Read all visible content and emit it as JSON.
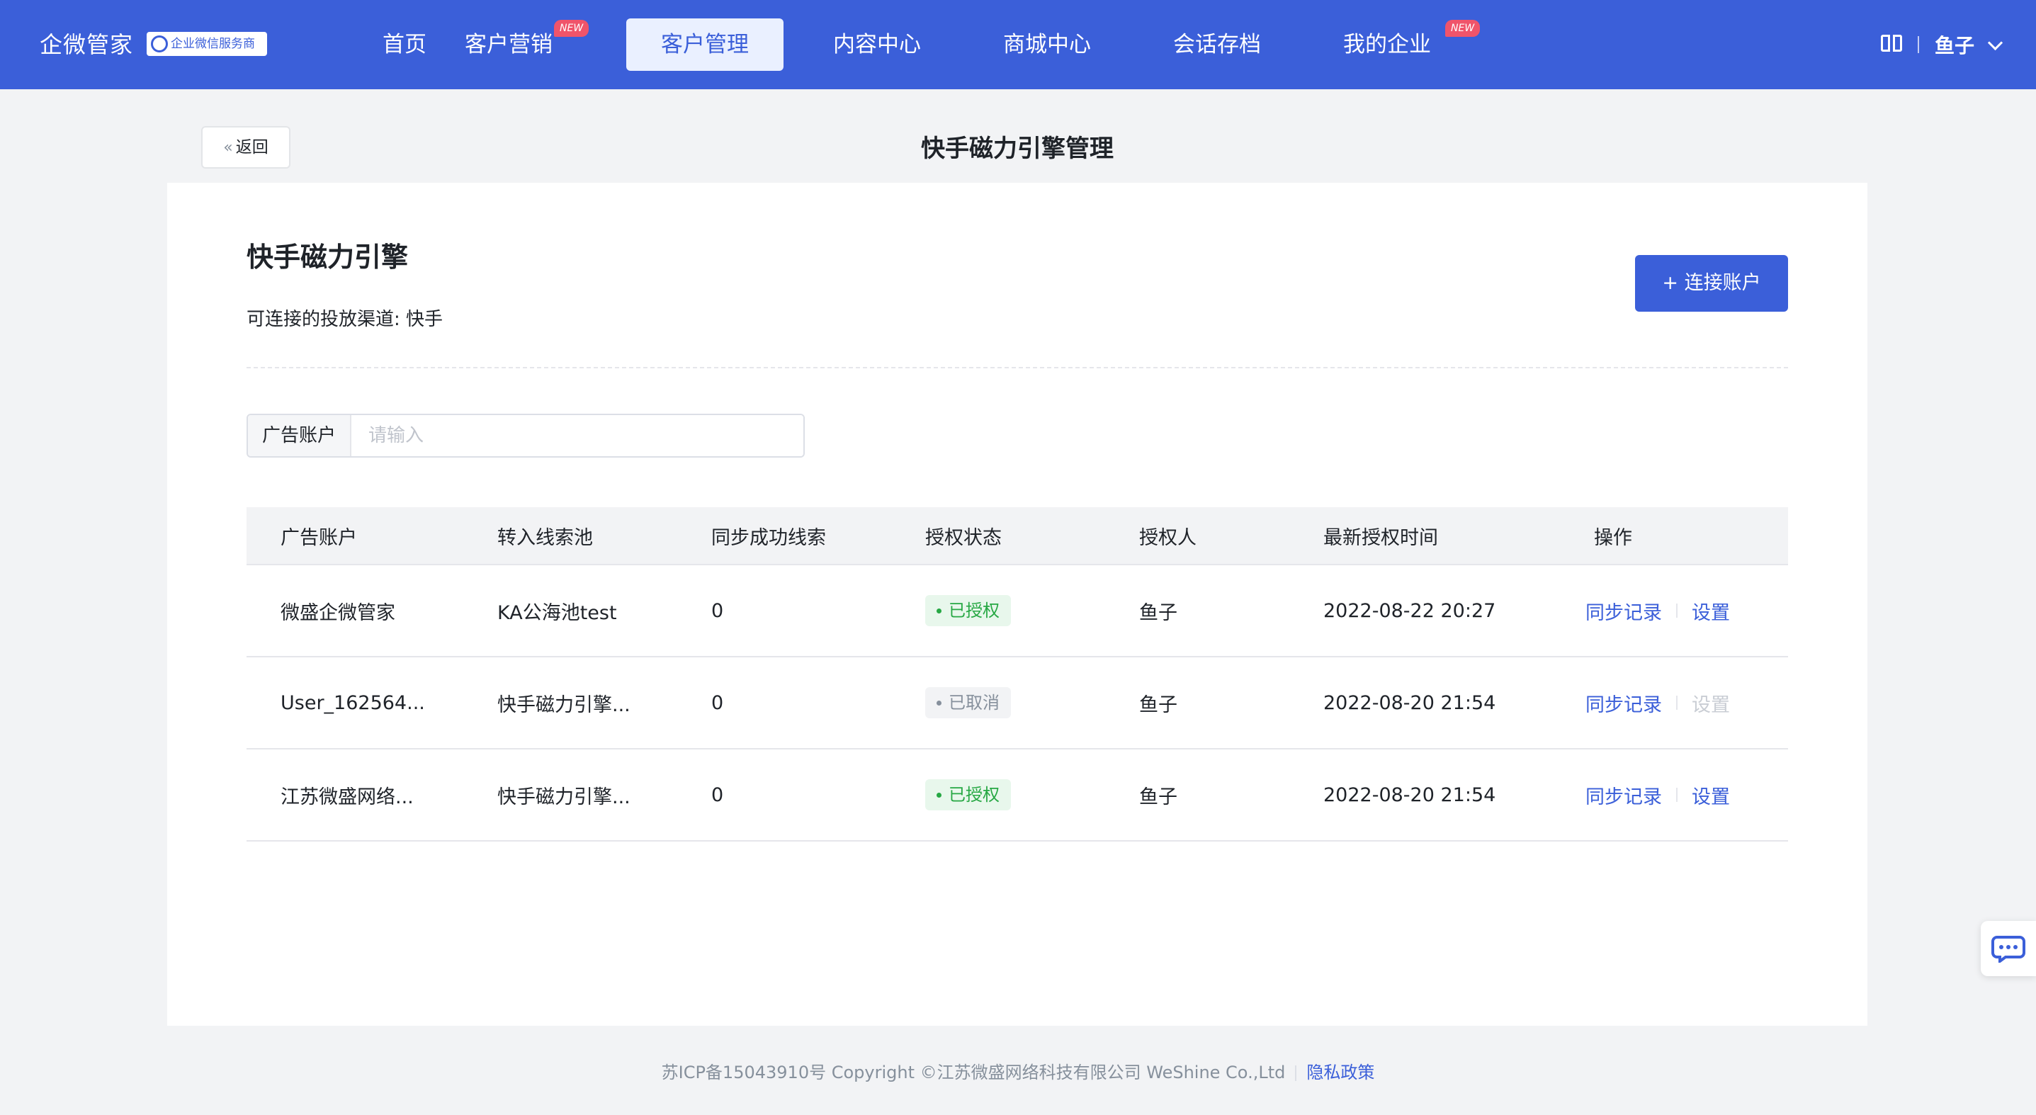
{
  "nav": {
    "brand": "企微管家",
    "badge": "企业微信服务商",
    "items": [
      {
        "label": "首页",
        "new": false
      },
      {
        "label": "客户营销",
        "new": true
      },
      {
        "label": "客户管理",
        "new": false
      },
      {
        "label": "内容中心",
        "new": false
      },
      {
        "label": "商城中心",
        "new": false
      },
      {
        "label": "会话存档",
        "new": false
      },
      {
        "label": "我的企业",
        "new": true
      }
    ],
    "active_index": 2,
    "new_badge_text": "NEW",
    "user": "鱼子"
  },
  "header": {
    "back_label": "返回",
    "title": "快手磁力引擎管理"
  },
  "section": {
    "title": "快手磁力引擎",
    "subtitle": "可连接的投放渠道: 快手",
    "connect_button": "+ 连接账户"
  },
  "filter": {
    "label": "广告账户",
    "placeholder": "请输入",
    "value": ""
  },
  "table": {
    "columns": [
      "广告账户",
      "转入线索池",
      "同步成功线索",
      "授权状态",
      "授权人",
      "最新授权时间",
      "操作"
    ],
    "rows": [
      {
        "account": "微盛企微管家",
        "pool": "KA公海池test",
        "synced": "0",
        "status": "已授权",
        "status_type": "ok",
        "owner": "鱼子",
        "time": "2022-08-22 20:27",
        "op1": "同步记录",
        "op2": "设置",
        "op2_disabled": false
      },
      {
        "account": "User_162564...",
        "pool": "快手磁力引擎...",
        "synced": "0",
        "status": "已取消",
        "status_type": "off",
        "owner": "鱼子",
        "time": "2022-08-20 21:54",
        "op1": "同步记录",
        "op2": "设置",
        "op2_disabled": true
      },
      {
        "account": "江苏微盛网络...",
        "pool": "快手磁力引擎...",
        "synced": "0",
        "status": "已授权",
        "status_type": "ok",
        "owner": "鱼子",
        "time": "2022-08-20 21:54",
        "op1": "同步记录",
        "op2": "设置",
        "op2_disabled": false
      }
    ]
  },
  "footer": {
    "copyright": "苏ICP备15043910号 Copyright ©江苏微盛网络科技有限公司 WeShine Co.,Ltd",
    "privacy": "隐私政策"
  },
  "colors": {
    "primary": "#3b5fd9",
    "authorized": "#27a844",
    "cancelled": "#86909c",
    "new_badge": "#f0546a"
  }
}
